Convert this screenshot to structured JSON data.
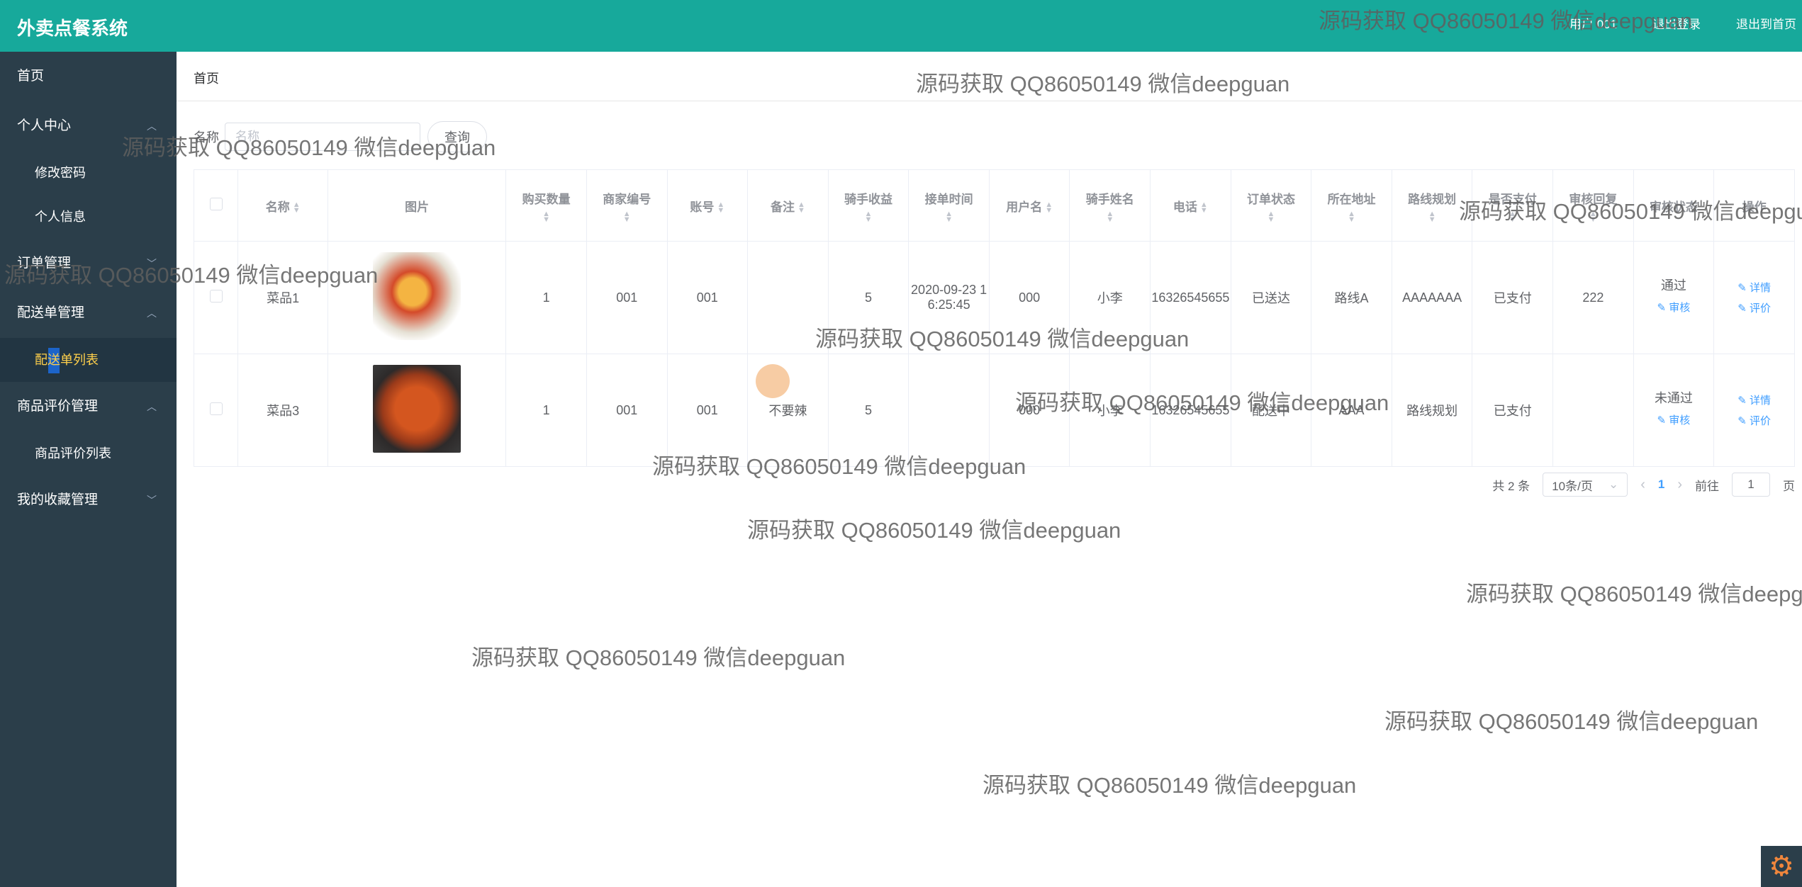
{
  "header": {
    "app_title": "外卖点餐系统",
    "user_label": "用户 001",
    "logout": "退出登录",
    "exit_to_home": "退出到首页"
  },
  "sidebar": {
    "items": [
      {
        "label": "首页"
      },
      {
        "label": "个人中心"
      },
      {
        "label": "修改密码"
      },
      {
        "label": "个人信息"
      },
      {
        "label": "订单管理"
      },
      {
        "label": "配送单管理"
      },
      {
        "label": "配送单列表"
      },
      {
        "label": "商品评价管理"
      },
      {
        "label": "商品评价列表"
      },
      {
        "label": "我的收藏管理"
      }
    ]
  },
  "breadcrumb": {
    "home": "首页"
  },
  "search": {
    "label": "名称",
    "placeholder": "名称",
    "button": "查询"
  },
  "table": {
    "headers": [
      "名称",
      "图片",
      "购买数量",
      "商家编号",
      "账号",
      "备注",
      "骑手收益",
      "接单时间",
      "用户名",
      "骑手姓名",
      "电话",
      "订单状态",
      "所在地址",
      "路线规划",
      "是否支付",
      "审核回复",
      "审核状态",
      "操作"
    ],
    "rows": [
      {
        "name": "菜品1",
        "quantity": "1",
        "merchant_no": "001",
        "account": "001",
        "remark": "",
        "rider_income": "5",
        "accept_time": "2020-09-23 16:25:45",
        "username": "000",
        "rider_name": "小李",
        "phone": "16326545655",
        "order_status": "已送达",
        "address": "路线A",
        "route": "AAAAAAA",
        "paid": "已支付",
        "review_reply": "222",
        "review_status": "通过"
      },
      {
        "name": "菜品3",
        "quantity": "1",
        "merchant_no": "001",
        "account": "001",
        "remark": "不要辣",
        "rider_income": "5",
        "accept_time": "",
        "username": "000",
        "rider_name": "小李",
        "phone": "16326545655",
        "order_status": "配送中",
        "address": "AAA",
        "route": "路线规划",
        "paid": "已支付",
        "review_reply": "",
        "review_status": "未通过"
      }
    ],
    "actions": {
      "detail": "详情",
      "audit": "审核",
      "rate": "评价"
    }
  },
  "pagination": {
    "total": "共 2 条",
    "page_size": "10条/页",
    "current": "1",
    "goto_prefix": "前往",
    "goto_value": "1",
    "goto_suffix": "页"
  },
  "watermark": "源码获取 QQ86050149 微信deepguan"
}
